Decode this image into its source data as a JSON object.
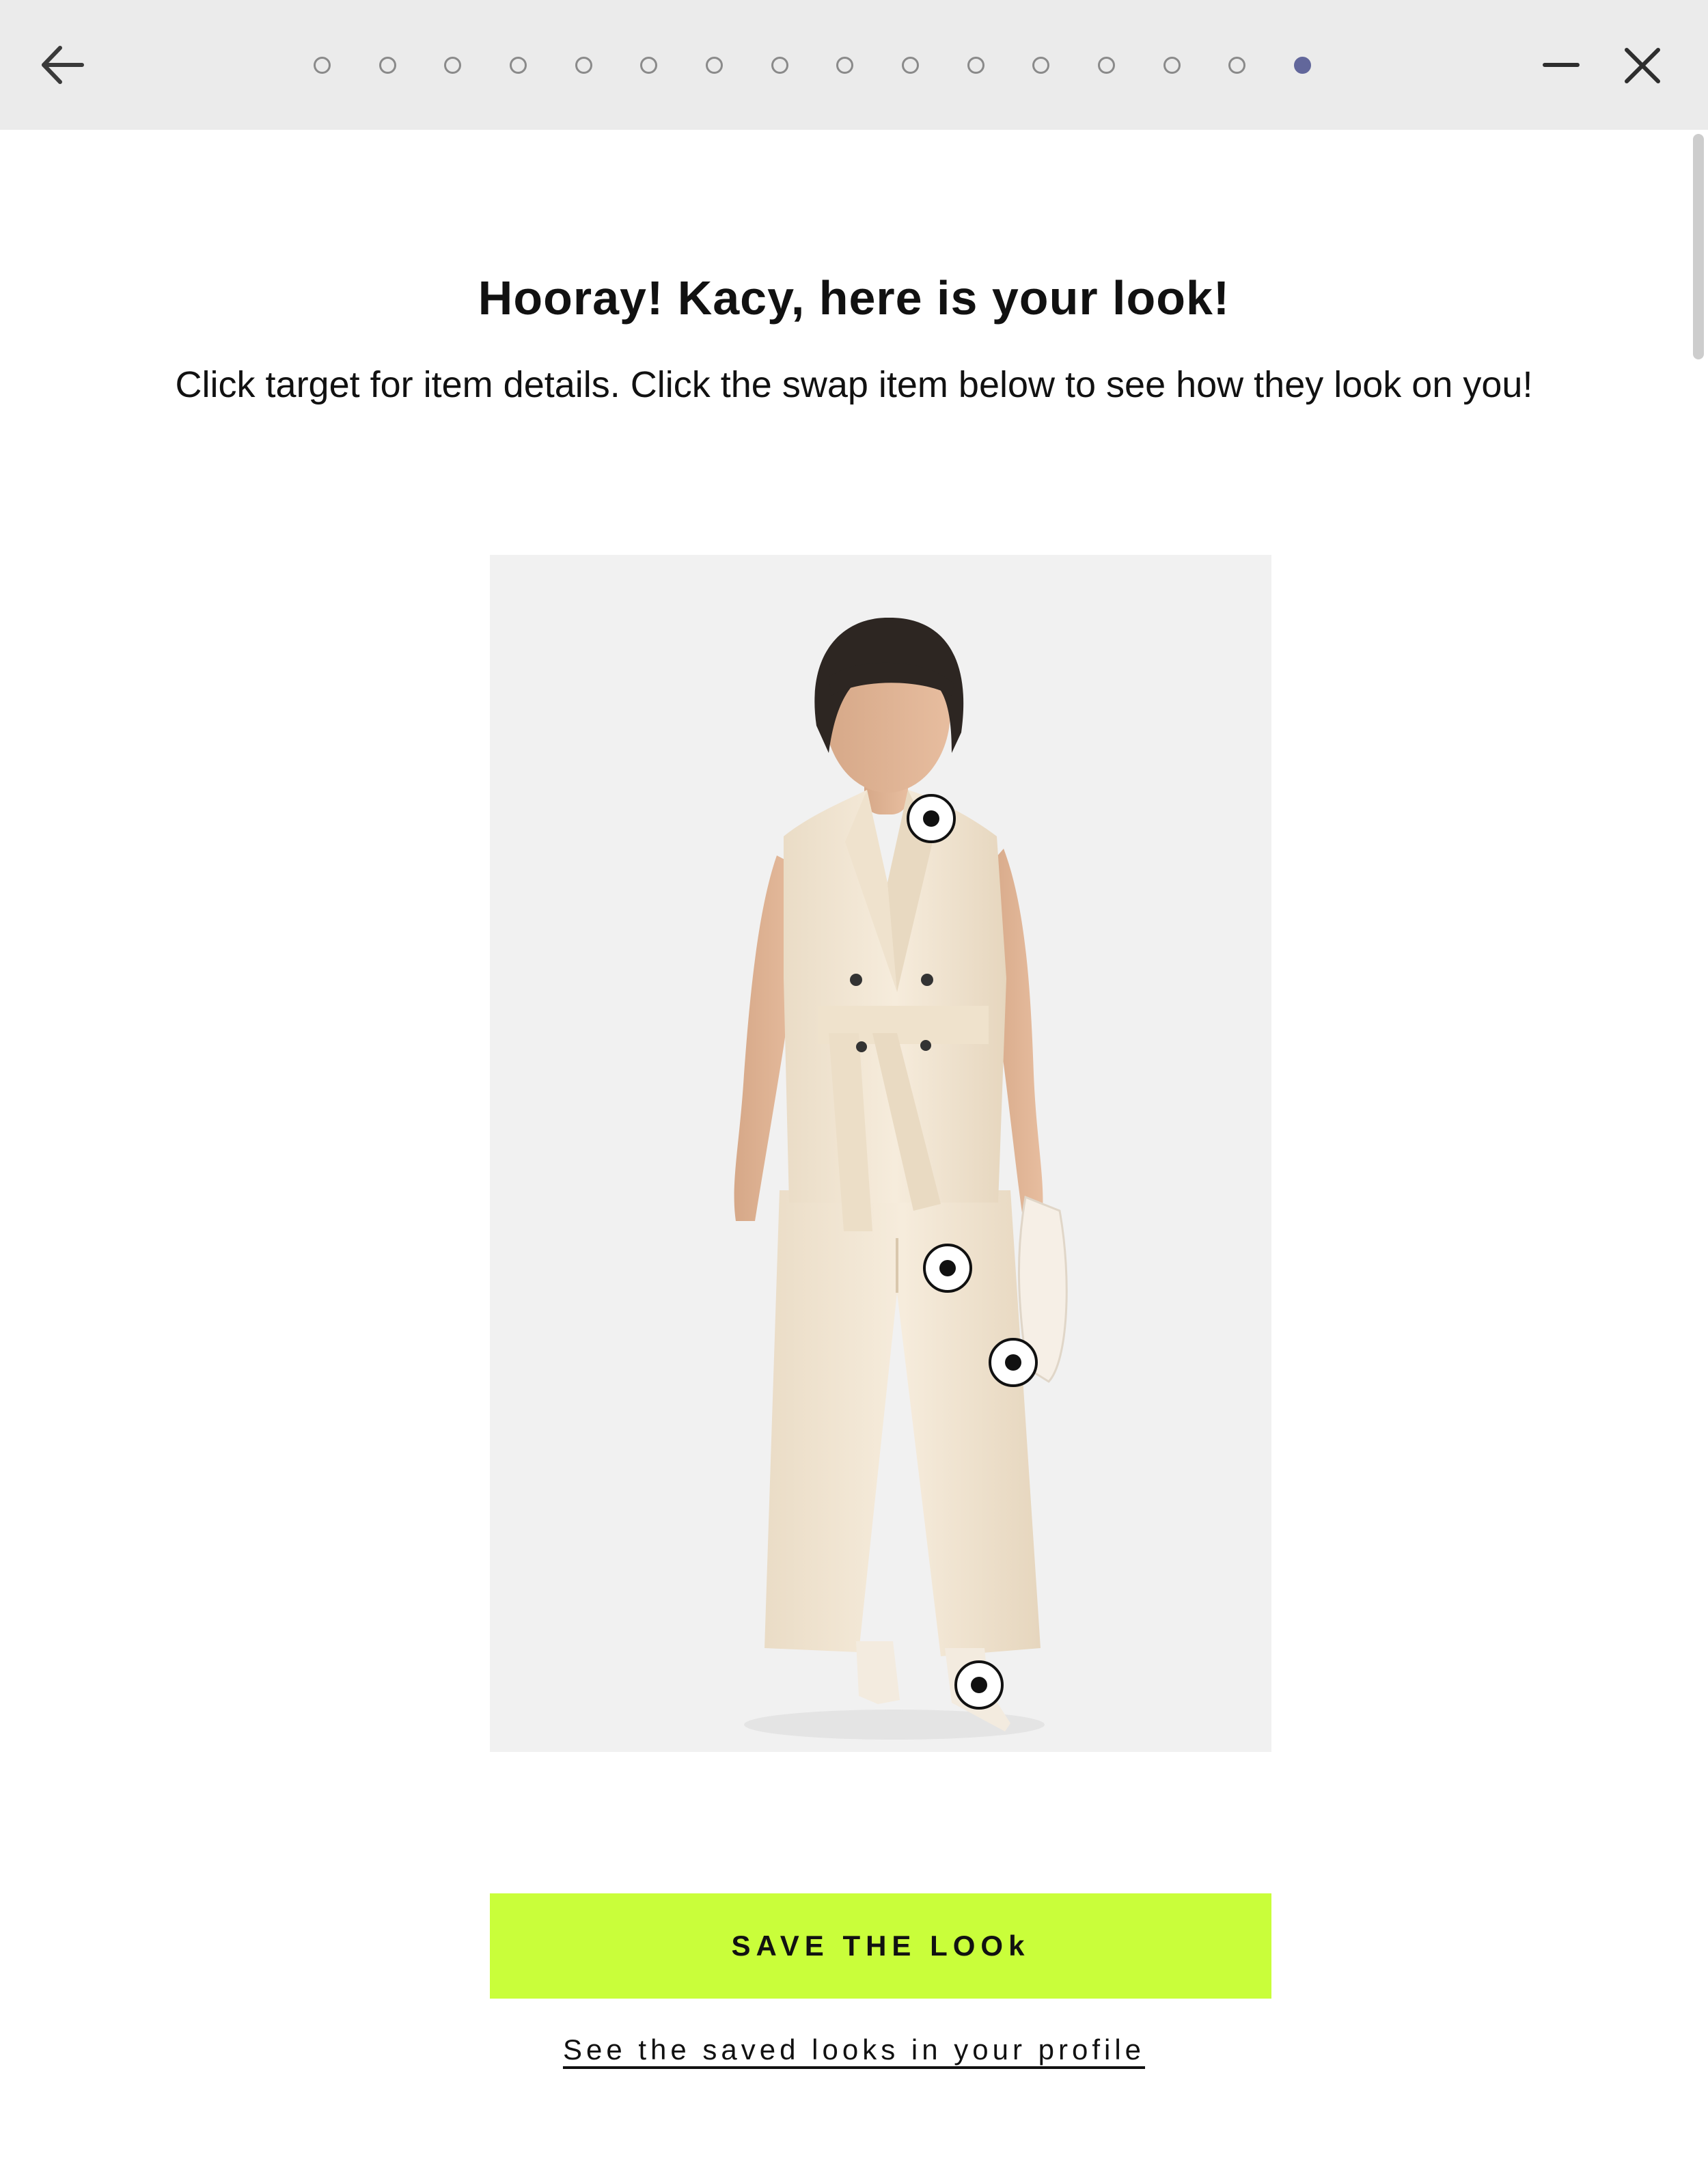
{
  "header": {
    "back_icon": "arrow-left-icon",
    "minimize_icon": "minimize-icon",
    "close_icon": "close-icon",
    "progress": {
      "total_steps": 16,
      "current_step": 16
    },
    "colors": {
      "bar_bg": "#ebebeb",
      "active_dot": "#62679b",
      "inactive_dot": "#8a8a8a"
    }
  },
  "main": {
    "title": "Hooray! Kacy, here is your look!",
    "subtitle": "Click target for item details. Click the swap item below to see how they look on you!",
    "look_image": {
      "alt": "model wearing cream sleeveless belted vest, wide-leg trousers, white shoulder bag and pointed boots"
    },
    "hotspots": [
      "vest",
      "trousers",
      "bag",
      "boots"
    ],
    "save_button_label": "SAVE THE LOOk",
    "saved_link_label": "See the saved looks in your profile",
    "colors": {
      "accent": "#c9fe3a",
      "text": "#111111"
    }
  }
}
